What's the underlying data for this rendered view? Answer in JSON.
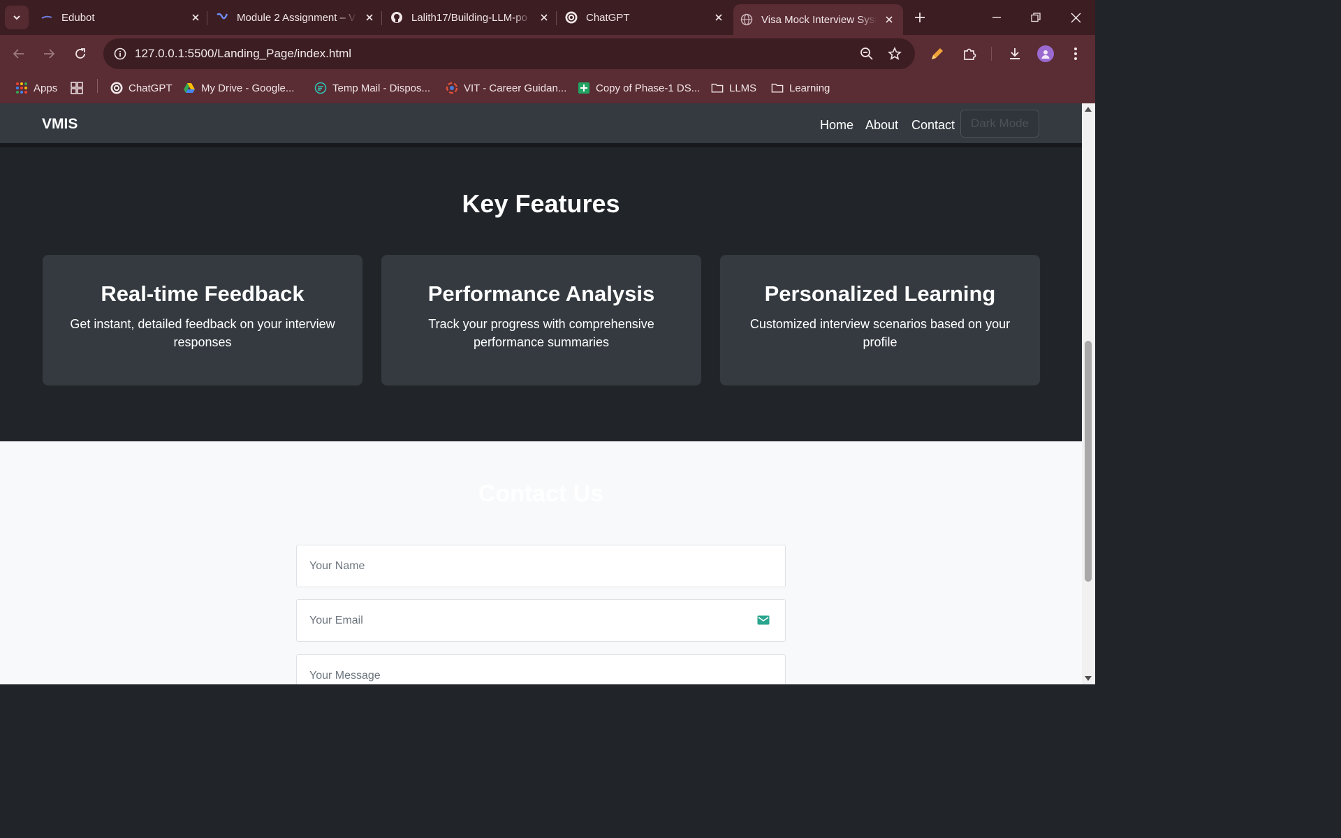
{
  "browser": {
    "tabs": [
      {
        "title": "Edubot",
        "icon": "edubot-icon",
        "active": false
      },
      {
        "title": "Module 2 Assignment – V",
        "icon": "module-icon",
        "active": false
      },
      {
        "title": "Lalith17/Building-LLM-po",
        "icon": "github-icon",
        "active": false
      },
      {
        "title": "ChatGPT",
        "icon": "chatgpt-icon",
        "active": false
      },
      {
        "title": "Visa Mock Interview Syste",
        "icon": "globe-icon",
        "active": true
      }
    ],
    "url": "127.0.0.1:5500/Landing_Page/index.html",
    "bookmarks": [
      {
        "label": "Apps",
        "icon": "apps-grid-icon"
      },
      {
        "label": "",
        "icon": "tab-groups-icon"
      },
      {
        "label": "ChatGPT",
        "icon": "chatgpt-icon"
      },
      {
        "label": "My Drive - Google...",
        "icon": "google-drive-icon"
      },
      {
        "label": "Temp Mail - Dispos...",
        "icon": "temp-mail-icon"
      },
      {
        "label": "VIT - Career Guidan...",
        "icon": "vit-icon"
      },
      {
        "label": "Copy of Phase-1 DS...",
        "icon": "google-sheets-icon"
      },
      {
        "label": "LLMS",
        "icon": "folder-icon"
      },
      {
        "label": "Learning",
        "icon": "folder-icon"
      }
    ],
    "colors": {
      "frame": "#3c1d22",
      "toolbar": "#5a2c33"
    }
  },
  "site": {
    "brand": "VMIS",
    "nav": {
      "home": "Home",
      "about": "About",
      "contact": "Contact",
      "dark_mode": "Dark Mode"
    },
    "features": {
      "title": "Key Features",
      "cards": [
        {
          "title": "Real-time Feedback",
          "text": "Get instant, detailed feedback on your interview responses"
        },
        {
          "title": "Performance Analysis",
          "text": "Track your progress with comprehensive performance summaries"
        },
        {
          "title": "Personalized Learning",
          "text": "Customized interview scenarios based on your profile"
        }
      ]
    },
    "contact": {
      "title": "Contact Us",
      "name_placeholder": "Your Name",
      "email_placeholder": "Your Email",
      "message_placeholder": "Your Message"
    },
    "colors": {
      "nav": "#343a40",
      "features_bg": "#212529",
      "card": "#343a40",
      "contact_bg": "#f8f9fa"
    }
  }
}
